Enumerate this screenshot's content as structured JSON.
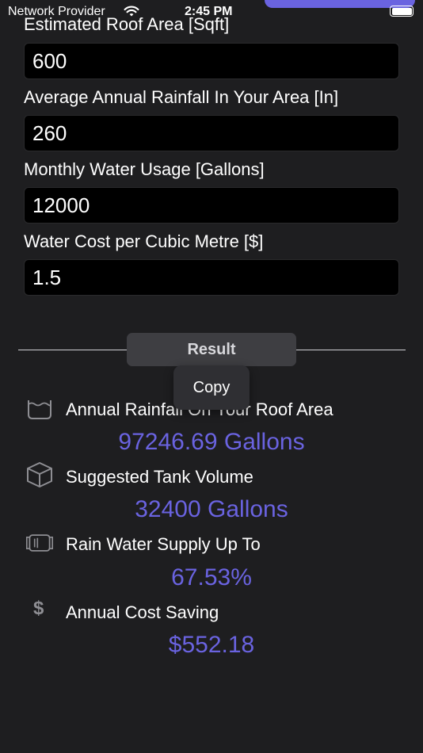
{
  "status_bar": {
    "carrier": "Network Provider",
    "time": "2:45 PM"
  },
  "form": {
    "fields": [
      {
        "label": "Estimated Roof Area [Sqft]",
        "value": "600"
      },
      {
        "label": "Average Annual Rainfall In Your Area [In]",
        "value": "260"
      },
      {
        "label": "Monthly Water Usage [Gallons]",
        "value": "12000"
      },
      {
        "label": "Water Cost per Cubic Metre [$]",
        "value": "1.5"
      }
    ]
  },
  "result_button": "Result",
  "context_menu": {
    "copy": "Copy"
  },
  "results": [
    {
      "label": "Annual Rainfall On Your Roof Area",
      "value": "97246.69 Gallons",
      "icon": "basin-icon"
    },
    {
      "label": "Suggested Tank Volume",
      "value": "32400 Gallons",
      "icon": "cube-icon"
    },
    {
      "label": "Rain Water Supply Up To",
      "value": "67.53%",
      "icon": "tank-icon"
    },
    {
      "label": "Annual Cost Saving",
      "value": "$552.18",
      "icon": "dollar-icon"
    }
  ],
  "colors": {
    "background": "#1e1e20",
    "accent": "#6a63e0",
    "field_background": "#000000",
    "button_background": "#3e3e42"
  }
}
